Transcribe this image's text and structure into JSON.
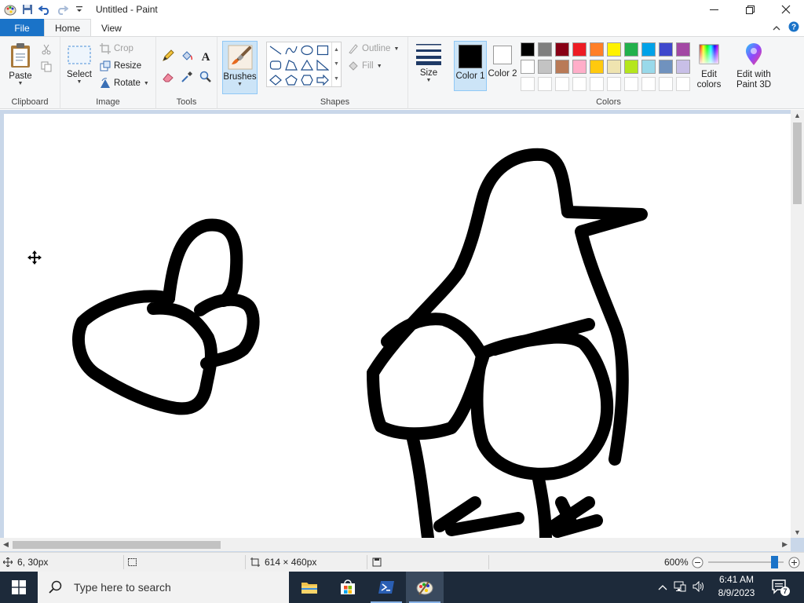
{
  "window": {
    "title": "Untitled - Paint"
  },
  "tabs": [
    {
      "label": "File"
    },
    {
      "label": "Home"
    },
    {
      "label": "View"
    }
  ],
  "ribbon": {
    "clipboard": {
      "label": "Clipboard",
      "paste": "Paste"
    },
    "image": {
      "label": "Image",
      "select": "Select",
      "crop": "Crop",
      "resize": "Resize",
      "rotate": "Rotate"
    },
    "tools": {
      "label": "Tools"
    },
    "brushes": "Brushes",
    "shapes": {
      "label": "Shapes",
      "outline": "Outline",
      "fill": "Fill"
    },
    "size": "Size",
    "colors": {
      "label": "Colors",
      "color1": "Color 1",
      "color2": "Color 2",
      "edit_colors": "Edit colors",
      "edit_3d": "Edit with Paint 3D",
      "color1_value": "#000000",
      "color2_value": "#ffffff",
      "palette_row1": [
        "#000000",
        "#7f7f7f",
        "#880015",
        "#ed1c24",
        "#ff7f27",
        "#fff200",
        "#22b14c",
        "#00a2e8",
        "#3f48cc",
        "#a349a4"
      ],
      "palette_row2": [
        "#ffffff",
        "#c3c3c3",
        "#b97a57",
        "#ffaec9",
        "#ffc90e",
        "#efe4b0",
        "#b5e61d",
        "#99d9ea",
        "#7092be",
        "#c8bfe7"
      ]
    }
  },
  "status": {
    "cursor_pos": "6, 30px",
    "image_size": "614 × 460px",
    "zoom": "600%",
    "zoom_slider_fraction": 0.92
  },
  "taskbar": {
    "search_placeholder": "Type here to search",
    "time": "6:41 AM",
    "date": "8/9/2023",
    "notification_count": "7"
  }
}
